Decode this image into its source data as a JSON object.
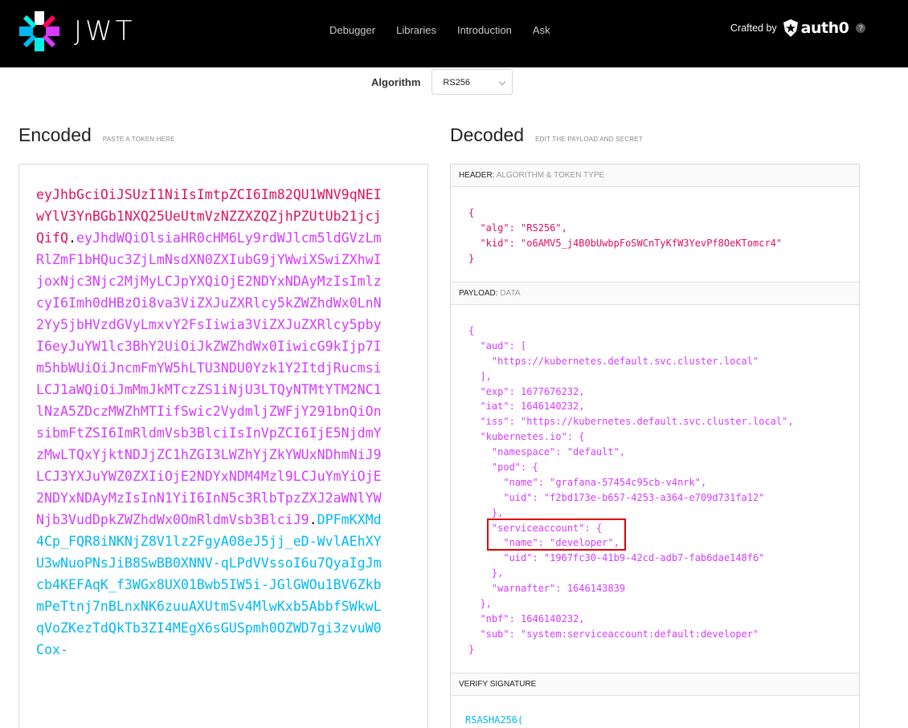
{
  "nav": {
    "logo_text": "JWT",
    "links": [
      "Debugger",
      "Libraries",
      "Introduction",
      "Ask"
    ],
    "crafted_by": "Crafted by",
    "brand": "auth0",
    "help": "?"
  },
  "algorithm": {
    "label": "Algorithm",
    "value": "RS256"
  },
  "encoded": {
    "title": "Encoded",
    "subtitle": "PASTE A TOKEN HERE",
    "token_header": "eyJhbGciOiJSUzI1NiIsImtpZCI6Im82QU1WNV9qNEIwYlV3YnBGb1NXQ25UeUtmVzNZZXZQZjhPZUtUb21jcjQifQ",
    "token_payload": "eyJhdWQiOlsiaHR0cHM6Ly9rdWJlcm5ldGVzLmRlZmF1bHQuc3ZjLmNsdXN0ZXIubG9jYWwiXSwiZXhwIjoxNjc3Njc2MjMyLCJpYXQiOjE2NDYxNDAyMzIsImlzcyI6Imh0dHBzOi8va3ViZXJuZXRlcy5kZWZhdWx0LnN2Yy5jbHVzdGVyLmxvY2FsIiwia3ViZXJuZXRlcy5pbyI6eyJuYW1lc3BhY2UiOiJkZWZhdWx0IiwicG9kIjp7Im5hbWUiOiJncmFmYW5hLTU3NDU0Yzk1Y2ItdjRucmsiLCJ1aWQiOiJmMmJkMTczZS1iNjU3LTQyNTMtYTM2NC1lNzA5ZDczMWZhMTIifSwic2VydmljZWFjY291bnQiOnsibmFtZSI6ImRldmVsb3BlciIsInVpZCI6IjE5NjdmYzMwLTQxYjktNDJjZC1hZGI3LWZhYjZkYWUxNDhmNiJ9LCJ3YXJuYWZ0ZXIiOjE2NDYxNDM4Mzl9LCJuYmYiOjE2NDYxNDAyMzIsInN1YiI6InN5c3RlbTpzZXJ2aWNlYWNjb3VudDpkZWZhdWx0OmRldmVsb3BlciJ9",
    "token_signature": "DPFmKXMd4Cp_FQR8iNKNjZ8V1lz2FgyA08eJ5jj_eD-WvlAEhXYU3wNuoPNsJiB8SwBB0XNNV-qLPdVVssoI6u7QyaIgJmcb4KEFAqK_f3WGx8UX01Bwb5IW5i-JGlGWOu1BV6ZkbmPeTtnj7nBLnxNK6zuuAXUtmSv4MlwKxb5AbbfSWkwLqVoZKezTdQkTb3ZI4MEgX6sGUSpmh0OZWD7gi3zvuW0Cox-"
  },
  "decoded": {
    "title": "Decoded",
    "subtitle": "EDIT THE PAYLOAD AND SECRET",
    "header_label": "HEADER:",
    "header_hint": "ALGORITHM & TOKEN TYPE",
    "header_lines": [
      "{",
      "  \"alg\": \"RS256\",",
      "  \"kid\": \"o6AMV5_j4B0bUwbpFoSWCnTyKfW3YevPf8OeKTomcr4\"",
      "}"
    ],
    "payload_label": "PAYLOAD:",
    "payload_hint": "DATA",
    "payload_lines": [
      "{",
      "  \"aud\": [",
      "    \"https://kubernetes.default.svc.cluster.local\"",
      "  ],",
      "  \"exp\": 1677676232,",
      "  \"iat\": 1646140232,",
      "  \"iss\": \"https://kubernetes.default.svc.cluster.local\",",
      "  \"kubernetes.io\": {",
      "    \"namespace\": \"default\",",
      "    \"pod\": {",
      "      \"name\": \"grafana-57454c95cb-v4nrk\",",
      "      \"uid\": \"f2bd173e-b657-4253-a364-e709d731fa12\"",
      "    },",
      "    \"serviceaccount\": {",
      "      \"name\": \"developer\",",
      "      \"uid\": \"1967fc30-41b9-42cd-adb7-fab6dae148f6\"",
      "    },",
      "    \"warnafter\": 1646143839",
      "  },",
      "  \"nbf\": 1646140232,",
      "  \"sub\": \"system:serviceaccount:default:developer\"",
      "}"
    ],
    "verify_label": "VERIFY SIGNATURE",
    "verify_code": "RSASHA256("
  },
  "colors": {
    "header": "#e0115f",
    "payload": "#d63aff",
    "signature": "#00b9f1",
    "highlight": "#e00000"
  }
}
